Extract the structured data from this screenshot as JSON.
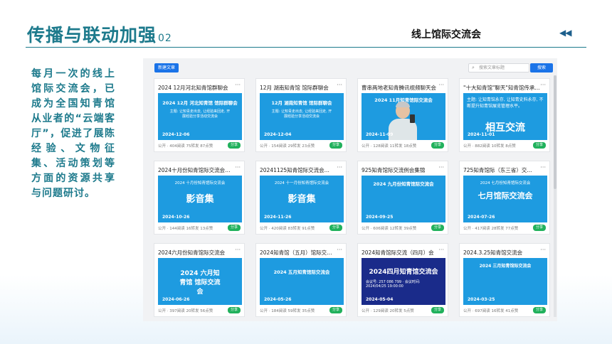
{
  "slide": {
    "title": "传播与联动加强",
    "number": "02",
    "subtitle": "线上馆际交流会",
    "nav_arrows": "◀◀",
    "description": "每月一次的线上馆际交流会，已成为全国知青馆从业者的“云端客厅”，促进了展陈经验、文物征集、活动策划等方面的资源共享与问题研讨。"
  },
  "toolbar": {
    "new_label": "新建文章",
    "search_placeholder": "搜索文章标题",
    "search_label": "搜索",
    "search_icon": "search-icon"
  },
  "colors": {
    "accent": "#1d7a8c",
    "brand_blue": "#1a73e8",
    "share_green": "#21b15c",
    "cover_blue": "#1e9be0"
  },
  "articles": [
    {
      "title": "2024 12月河北知青馆群聊会",
      "cover_big": "2024 12月 河北知青馆 馆际群聊会",
      "cover_small": "主题: 让知青走出去, 让经验来回走, 开展经验分享活动交流会",
      "cover_date": "2024-12-06",
      "meta": "公开 · 404阅读 75转发 87点赞",
      "share": "分享"
    },
    {
      "title": "12月 湖南知青馆 馆际群聊会",
      "cover_big": "12月 湖南知青馆 馆际群聊会",
      "cover_small": "主题: 让知青走出去, 让经验来回走, 开展经验分享活动交流会",
      "cover_date": "2024-12-04",
      "meta": "公开 · 154阅读 29转发 23点赞",
      "share": "分享"
    },
    {
      "title": "曹串两地老知青腾讯视频聊天会",
      "cover_big": "2024 11月知青馆际交流会",
      "cover_small": "",
      "cover_date": "2024-11-09",
      "meta": "公开 · 128阅读 11转发 18点赞",
      "share": "分享"
    },
    {
      "title": "\"十大知青馆\"聊天\"知青馆传承...",
      "cover_big": "相互交流",
      "cover_small": "主题: 让知青馆永存, 让知青史料永存, 不断提升知青馆展览管理水平。",
      "cover_date": "2024-11-01",
      "meta": "公开 · 882阅读 10转发 8点赞",
      "share": "分享"
    },
    {
      "title": "2024十月份知青馆际交流会影...",
      "cover_big": "影音集",
      "cover_small": "2024 十月份知青馆际交流会",
      "cover_date": "2024-10-26",
      "meta": "公开 · 144阅读 16转发 13点赞",
      "share": "分享"
    },
    {
      "title": "20241125知青馆际交流会...",
      "cover_big": "影音集",
      "cover_small": "2024 十一月份知青馆际交流会",
      "cover_date": "2024-11-26",
      "meta": "公开 · 420阅读 83转发 91点赞",
      "share": "分享"
    },
    {
      "title": "925知青馆际交流例会集锦",
      "cover_big": "2024 九月份知青馆际交流会",
      "cover_small": "",
      "cover_date": "2024-09-25",
      "meta": "公开 · 606阅读 12转发 39点赞",
      "share": "分享"
    },
    {
      "title": "725知青馆际（东三省）交...",
      "cover_big": "七月馆际交流会",
      "cover_small": "2024 七月份知青馆际交流会",
      "cover_date": "2024-07-26",
      "meta": "公开 · 417阅读 28转发 77点赞",
      "share": "分享"
    },
    {
      "title": "2024六月份知青馆际交流会",
      "cover_big": "2024 六月知青馆 馆际交流会",
      "cover_small": "",
      "cover_date": "2024-06-26",
      "meta": "公开 · 397阅读 20转发 56点赞",
      "share": "分享"
    },
    {
      "title": "2024知青馆（五月）馆际交流会",
      "cover_big": "2024 五月知青馆际交流会",
      "cover_small": "",
      "cover_date": "2024-05-26",
      "meta": "公开 · 184阅读 59转发 35点赞",
      "share": "分享"
    },
    {
      "title": "2024知青馆际交流（四月）会",
      "cover_big": "2024四月知青馆交流会",
      "cover_small": "会议号: 257 086 799 · 会议时间: 2024/04/25 19:00:00",
      "cover_date": "2024-05-04",
      "meta": "公开 · 129阅读 20转发 5点赞",
      "share": "分享"
    },
    {
      "title": "2024.3.25知青馆交流会",
      "cover_big": "2024 三月知青馆际交流会",
      "cover_small": "",
      "cover_date": "2024-03-25",
      "meta": "公开 · 697阅读 16转发 41点赞",
      "share": "分享"
    }
  ]
}
